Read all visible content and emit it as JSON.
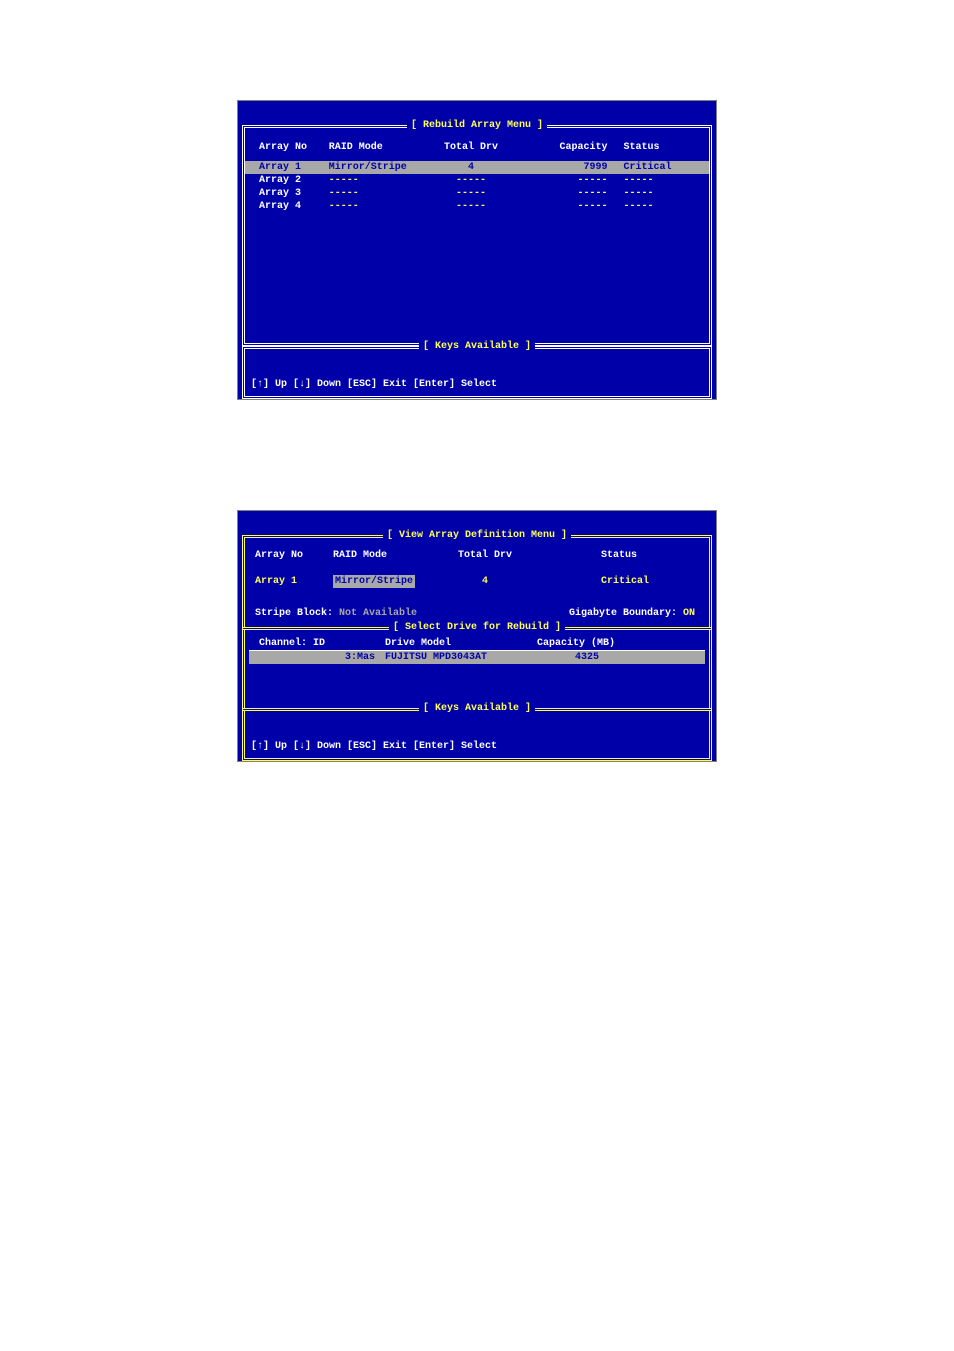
{
  "screen1": {
    "title": "[ Rebuild Array Menu ]",
    "headers": {
      "arrayno": "Array No",
      "raidmode": "RAID Mode",
      "totaldrv": "Total Drv",
      "capacity": "Capacity",
      "status": "Status"
    },
    "rows": [
      {
        "arrayno": "Array  1",
        "raidmode": "Mirror/Stripe",
        "totaldrv": "4",
        "capacity": "7999",
        "status": "Critical",
        "highlighted": true
      },
      {
        "arrayno": "Array  2",
        "raidmode": "-----",
        "totaldrv": "-----",
        "capacity": "-----",
        "status": "-----",
        "highlighted": false
      },
      {
        "arrayno": "Array  3",
        "raidmode": "-----",
        "totaldrv": "-----",
        "capacity": "-----",
        "status": "-----",
        "highlighted": false
      },
      {
        "arrayno": "Array  4",
        "raidmode": "-----",
        "totaldrv": "-----",
        "capacity": "-----",
        "status": "-----",
        "highlighted": false
      }
    ],
    "keys_title": "[ Keys Available ]",
    "keys_text": "[↑] Up  [↓] Down  [ESC] Exit  [Enter] Select"
  },
  "screen2": {
    "title": "[ View Array Definition Menu ]",
    "headers": {
      "arrayno": "Array No",
      "raidmode": "RAID Mode",
      "totaldrv": "Total Drv",
      "status": "Status"
    },
    "row": {
      "arrayno": "Array  1",
      "raidmode": "Mirror/Stripe",
      "totaldrv": "4",
      "status": "Critical"
    },
    "stripe_label": "Stripe Block:",
    "stripe_value": "Not Available",
    "gig_label": "Gigabyte Boundary:",
    "gig_value": "ON",
    "select_title": "[ Select Drive for Rebuild ]",
    "drive_headers": {
      "channel": "Channel: ID",
      "model": "Drive Model",
      "capacity": "Capacity (MB)"
    },
    "drive_row": {
      "channel": "3:Mas",
      "model": "FUJITSU MPD3043AT",
      "capacity": "4325"
    },
    "keys_title": "[ Keys Available ]",
    "keys_text": "[↑] Up  [↓] Down  [ESC] Exit  [Enter] Select"
  }
}
